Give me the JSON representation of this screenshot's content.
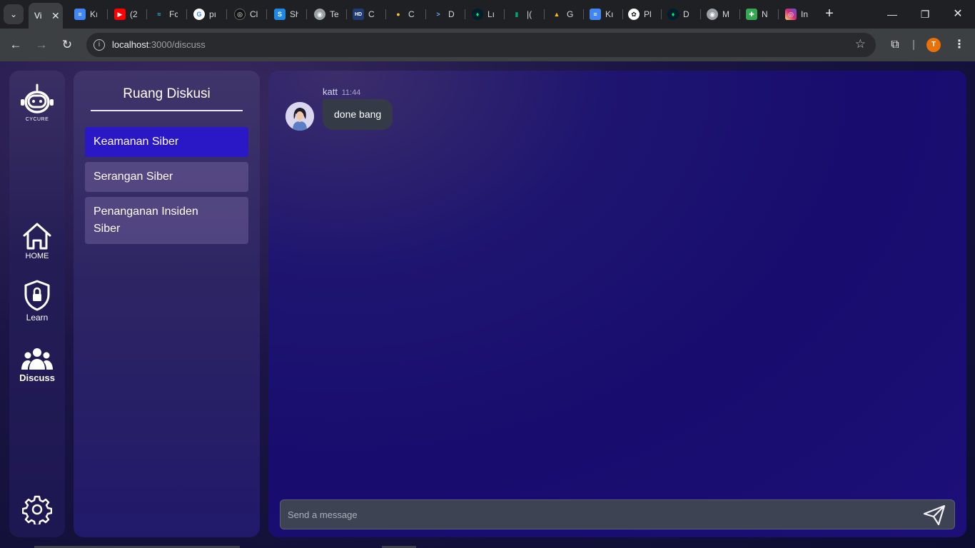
{
  "browser": {
    "tabs": [
      {
        "title": "Vi",
        "icon": "app-icon",
        "color": "#5f6368"
      },
      {
        "title": "Kı",
        "icon": "docs-icon",
        "color": "#4285f4"
      },
      {
        "title": "(2",
        "icon": "youtube-icon",
        "color": "#ff0000"
      },
      {
        "title": "Fc",
        "icon": "tailwind-icon",
        "color": "#38bdf8"
      },
      {
        "title": "pı",
        "icon": "google-icon",
        "color": "#ffffff"
      },
      {
        "title": "Cl",
        "icon": "dark-circle-icon",
        "color": "#111111"
      },
      {
        "title": "Sh",
        "icon": "s-icon",
        "color": "#1e88e5"
      },
      {
        "title": "Te",
        "icon": "globe-icon",
        "color": "#9aa0a6"
      },
      {
        "title": "C",
        "icon": "hd-icon",
        "color": "#1f3b73"
      },
      {
        "title": "C",
        "icon": "person-icon",
        "color": "#2e7d32"
      },
      {
        "title": "D",
        "icon": "terminal-icon",
        "color": "#0d47a1"
      },
      {
        "title": "Lı",
        "icon": "leaf-icon",
        "color": "#00684a"
      },
      {
        "title": "|(",
        "icon": "green-bar-icon",
        "color": "#00a86b"
      },
      {
        "title": "G",
        "icon": "drive-icon",
        "color": "#fbbc04"
      },
      {
        "title": "Kı",
        "icon": "docs-icon",
        "color": "#4285f4"
      },
      {
        "title": "Pl",
        "icon": "openai-icon",
        "color": "#ffffff"
      },
      {
        "title": "D",
        "icon": "leaf-icon",
        "color": "#00684a"
      },
      {
        "title": "M",
        "icon": "globe-icon",
        "color": "#9aa0a6"
      },
      {
        "title": "N",
        "icon": "sheets-icon",
        "color": "#34a853"
      },
      {
        "title": "In",
        "icon": "instagram-icon",
        "color": "#e1306c"
      }
    ],
    "new_tab": "+",
    "url_host": "localhost",
    "url_path": ":3000/discuss",
    "profile_initial": "T"
  },
  "rail": {
    "logo_label": "CYCURE",
    "items": [
      {
        "label": "HOME",
        "icon": "home-icon"
      },
      {
        "label": "Learn",
        "icon": "shield-lock-icon"
      },
      {
        "label": "Discuss",
        "icon": "group-icon",
        "active": true
      }
    ],
    "settings_icon": "gear-icon"
  },
  "rooms": {
    "title": "Ruang Diskusi",
    "items": [
      {
        "label": "Keamanan Siber",
        "active": true
      },
      {
        "label": "Serangan Siber"
      },
      {
        "label": "Penanganan Insiden Siber"
      }
    ]
  },
  "chat": {
    "messages": [
      {
        "user": "katt",
        "time": "11:44",
        "text": "done bang"
      }
    ],
    "composer_placeholder": "Send a message"
  },
  "colors": {
    "accent": "#2a17c6",
    "bubble": "#343a46"
  }
}
